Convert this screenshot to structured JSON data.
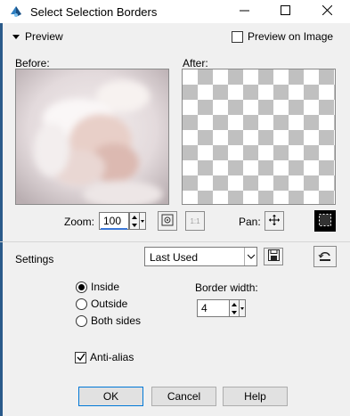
{
  "window": {
    "title": "Select Selection Borders",
    "minimize_icon": "minimize-icon",
    "maximize_icon": "maximize-icon",
    "close_icon": "close-icon"
  },
  "preview": {
    "toggle_label": "Preview",
    "preview_on_image_label": "Preview on Image",
    "preview_on_image_checked": false,
    "before_label": "Before:",
    "after_label": "After:"
  },
  "zoom": {
    "label": "Zoom:",
    "value": "100",
    "fit_icon": "fit-to-window-icon",
    "actual_size_icon": "actual-size-icon",
    "actual_size_text": "1:1",
    "pan_label": "Pan:",
    "pan_icon": "pan-icon",
    "marquee_icon": "marquee-icon"
  },
  "settings": {
    "label": "Settings",
    "selected": "Last Used",
    "save_icon": "save-icon",
    "reset_icon": "reset-icon"
  },
  "options": {
    "radios": [
      {
        "label": "Inside",
        "checked": true
      },
      {
        "label": "Outside",
        "checked": false
      },
      {
        "label": "Both sides",
        "checked": false
      }
    ],
    "border_width_label": "Border width:",
    "border_width_value": "4",
    "antialias_label": "Anti-alias",
    "antialias_checked": true
  },
  "buttons": {
    "ok": "OK",
    "cancel": "Cancel",
    "help": "Help"
  },
  "colors": {
    "accent": "#0078d7",
    "checker": "#c0c0c0"
  }
}
